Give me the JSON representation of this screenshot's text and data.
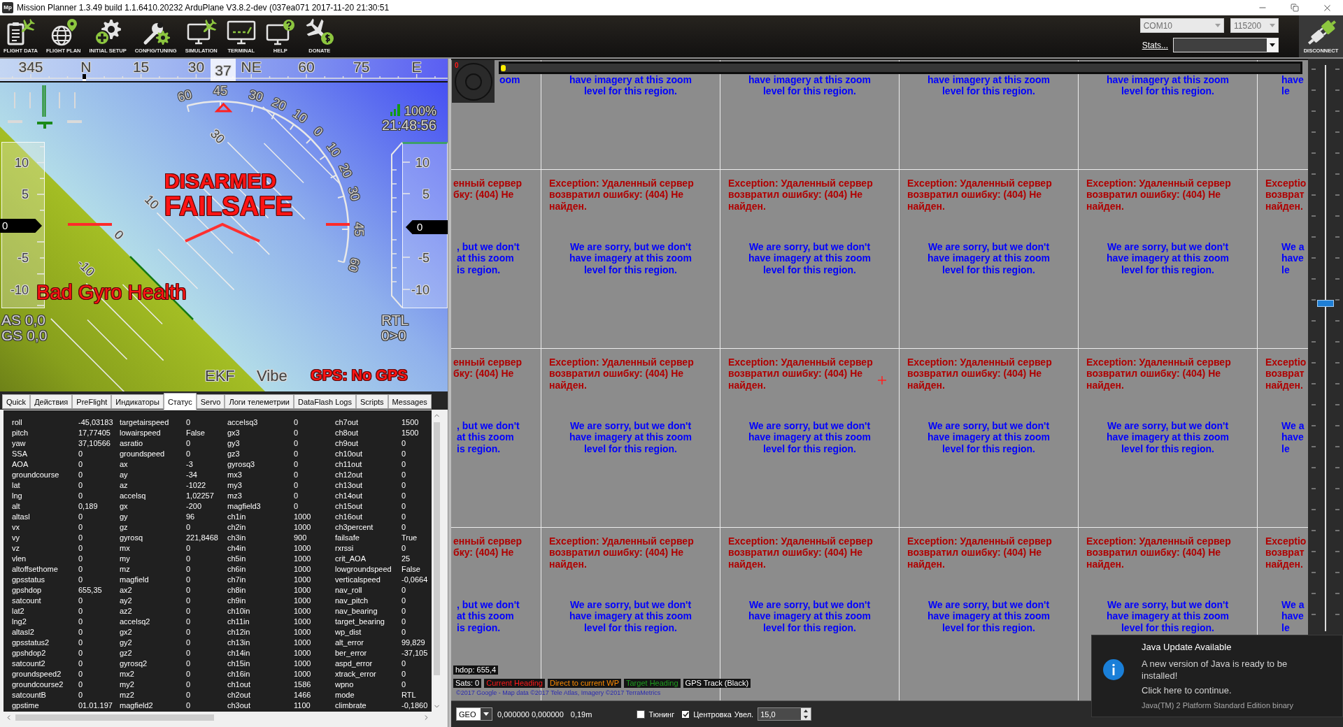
{
  "window": {
    "icon_text": "Mp",
    "title": "Mission Planner 1.3.49 build 1.1.6410.20232 ArduPlane V3.8.2-dev (037ea071 2017-11-20 21:30:51"
  },
  "toolbar": {
    "buttons": [
      {
        "kind": "flight_data",
        "label": "FLIGHT DATA"
      },
      {
        "kind": "flight_plan",
        "label": "FLIGHT PLAN"
      },
      {
        "kind": "initial_setup",
        "label": "INITIAL SETUP"
      },
      {
        "kind": "config",
        "label": "CONFIG/TUNING"
      },
      {
        "kind": "simulation",
        "label": "SIMULATION"
      },
      {
        "kind": "terminal",
        "label": "TERMINAL"
      },
      {
        "kind": "help",
        "label": "HELP"
      },
      {
        "kind": "donate",
        "label": "DONATE"
      }
    ],
    "port": {
      "value": "COM10",
      "disabled": true
    },
    "baud": {
      "value": "115200",
      "disabled": true
    },
    "stats_link": "Stats...",
    "connect_button": "DISCONNECT"
  },
  "hud": {
    "compass": {
      "marks": [
        "345",
        "N",
        "15",
        "30",
        "NE",
        "60",
        "75",
        "E"
      ],
      "heading": "37"
    },
    "roll_scale": [
      "60",
      "45",
      "30",
      "20",
      "10",
      "0",
      "10",
      "20",
      "30",
      "45",
      "60"
    ],
    "pitch_labels": [
      "30",
      "10",
      "0",
      "-10"
    ],
    "battery": "100%",
    "clock": "21:48:56",
    "arm_status": "DISARMED",
    "failsafe": "FAILSAFE",
    "message": "Bad Gyro Health",
    "speed_tape": {
      "labels": [
        "10",
        "5",
        "-5",
        "-10"
      ],
      "value": "0"
    },
    "alt_tape": {
      "labels": [
        "10",
        "5",
        "-5",
        "-10"
      ],
      "value": "0"
    },
    "airspeed": "AS 0,0",
    "groundspeed": "GS 0,0",
    "mode": "RTL",
    "waypoint": "0>0",
    "indicators": [
      {
        "label": "EKF",
        "alert": false
      },
      {
        "label": "Vibe",
        "alert": false
      },
      {
        "label": "GPS: No GPS",
        "alert": true
      }
    ]
  },
  "tabs": [
    {
      "label": "Quick",
      "selected": false
    },
    {
      "label": "Действия",
      "selected": false
    },
    {
      "label": "PreFlight",
      "selected": false
    },
    {
      "label": "Индикаторы",
      "selected": false
    },
    {
      "label": "Статус",
      "selected": true
    },
    {
      "label": "Servo",
      "selected": false
    },
    {
      "label": "Логи телеметрии",
      "selected": false
    },
    {
      "label": "DataFlash Logs",
      "selected": false
    },
    {
      "label": "Scripts",
      "selected": false
    },
    {
      "label": "Messages",
      "selected": false
    }
  ],
  "status_table": {
    "rows": [
      [
        "roll",
        "-45,03183",
        "targetairspeed",
        "0",
        "accelsq3",
        "0",
        "ch7out",
        "1500"
      ],
      [
        "pitch",
        "17,77405",
        "lowairspeed",
        "False",
        "gx3",
        "0",
        "ch8out",
        "1500"
      ],
      [
        "yaw",
        "37,10566",
        "asratio",
        "0",
        "gy3",
        "0",
        "ch9out",
        "0"
      ],
      [
        "SSA",
        "0",
        "groundspeed",
        "0",
        "gz3",
        "0",
        "ch10out",
        "0"
      ],
      [
        "AOA",
        "0",
        "ax",
        "-3",
        "gyrosq3",
        "0",
        "ch11out",
        "0"
      ],
      [
        "groundcourse",
        "0",
        "ay",
        "-34",
        "mx3",
        "0",
        "ch12out",
        "0"
      ],
      [
        "lat",
        "0",
        "az",
        "-1022",
        "my3",
        "0",
        "ch13out",
        "0"
      ],
      [
        "lng",
        "0",
        "accelsq",
        "1,02257",
        "mz3",
        "0",
        "ch14out",
        "0"
      ],
      [
        "alt",
        "0,189",
        "gx",
        "-200",
        "magfield3",
        "0",
        "ch15out",
        "0"
      ],
      [
        "altasl",
        "0",
        "gy",
        "96",
        "ch1in",
        "1000",
        "ch16out",
        "0"
      ],
      [
        "vx",
        "0",
        "gz",
        "0",
        "ch2in",
        "1000",
        "ch3percent",
        "0"
      ],
      [
        "vy",
        "0",
        "gyrosq",
        "221,8468",
        "ch3in",
        "900",
        "failsafe",
        "True"
      ],
      [
        "vz",
        "0",
        "mx",
        "0",
        "ch4in",
        "1000",
        "rxrssi",
        "0"
      ],
      [
        "vlen",
        "0",
        "my",
        "0",
        "ch5in",
        "1000",
        "crit_AOA",
        "25"
      ],
      [
        "altoffsethome",
        "0",
        "mz",
        "0",
        "ch6in",
        "1000",
        "lowgroundspeed",
        "False"
      ],
      [
        "gpsstatus",
        "0",
        "magfield",
        "0",
        "ch7in",
        "1000",
        "verticalspeed",
        "-0,0664"
      ],
      [
        "gpshdop",
        "655,35",
        "ax2",
        "0",
        "ch8in",
        "1000",
        "nav_roll",
        "0"
      ],
      [
        "satcount",
        "0",
        "ay2",
        "0",
        "ch9in",
        "1000",
        "nav_pitch",
        "0"
      ],
      [
        "lat2",
        "0",
        "az2",
        "0",
        "ch10in",
        "1000",
        "nav_bearing",
        "0"
      ],
      [
        "lng2",
        "0",
        "accelsq2",
        "0",
        "ch11in",
        "1000",
        "target_bearing",
        "0"
      ],
      [
        "altasl2",
        "0",
        "gx2",
        "0",
        "ch12in",
        "1000",
        "wp_dist",
        "0"
      ],
      [
        "gpsstatus2",
        "0",
        "gy2",
        "0",
        "ch13in",
        "1000",
        "alt_error",
        "99,829"
      ],
      [
        "gpshdop2",
        "0",
        "gz2",
        "0",
        "ch14in",
        "1000",
        "ber_error",
        "-37,105"
      ],
      [
        "satcount2",
        "0",
        "gyrosq2",
        "0",
        "ch15in",
        "1000",
        "aspd_error",
        "0"
      ],
      [
        "groundspeed2",
        "0",
        "mx2",
        "0",
        "ch16in",
        "1000",
        "xtrack_error",
        "0"
      ],
      [
        "groundcourse2",
        "0",
        "my2",
        "0",
        "ch1out",
        "1586",
        "wpno",
        "0"
      ],
      [
        "satcountB",
        "0",
        "mz2",
        "0",
        "ch2out",
        "1466",
        "mode",
        "RTL"
      ],
      [
        "gpstime",
        "01.01.197",
        "magfield2",
        "0",
        "ch3out",
        "1100",
        "climbrate",
        "-0,1860"
      ]
    ]
  },
  "map": {
    "tiles": [
      [
        {
          "message": [
            "oom"
          ]
        },
        {
          "message": [
            "have imagery at this zoom",
            "level for this region."
          ]
        },
        {
          "message": [
            "have imagery at this zoom",
            "level for this region."
          ]
        },
        {
          "message": [
            "have imagery at this zoom",
            "level for this region."
          ]
        },
        {
          "message": [
            "have imagery at this zoom",
            "level for this region."
          ]
        },
        {
          "message": [
            "have",
            "le"
          ]
        }
      ],
      [
        {
          "error": [
            "енный сервер",
            "бку: (404) Не"
          ],
          "message": [
            ", but we don't",
            "at this zoom",
            "is region."
          ]
        },
        {
          "error": [
            "Exception: Удаленный сервер",
            "возвратил ошибку: (404) Не",
            "найден."
          ],
          "message": [
            "We are sorry, but we don't",
            "have imagery at this zoom",
            "level for this region."
          ]
        },
        {
          "error": [
            "Exception: Удаленный сервер",
            "возвратил ошибку: (404) Не",
            "найден."
          ],
          "message": [
            "We are sorry, but we don't",
            "have imagery at this zoom",
            "level for this region."
          ]
        },
        {
          "error": [
            "Exception: Удаленный сервер",
            "возвратил ошибку: (404) Не",
            "найден."
          ],
          "message": [
            "We are sorry, but we don't",
            "have imagery at this zoom",
            "level for this region."
          ]
        },
        {
          "error": [
            "Exception: Удаленный сервер",
            "возвратил ошибку: (404) Не",
            "найден."
          ],
          "message": [
            "We are sorry, but we don't",
            "have imagery at this zoom",
            "level for this region."
          ]
        },
        {
          "error": [
            "Exceptio",
            "возврат",
            "найден."
          ],
          "message": [
            "We a",
            "have",
            "le"
          ]
        }
      ],
      [
        {
          "error": [
            "енный сервер",
            "бку: (404) Не"
          ],
          "message": [
            ", but we don't",
            "at this zoom",
            "is region."
          ]
        },
        {
          "error": [
            "Exception: Удаленный сервер",
            "возвратил ошибку: (404) Не",
            "найден."
          ],
          "message": [
            "We are sorry, but we don't",
            "have imagery at this zoom",
            "level for this region."
          ]
        },
        {
          "error": [
            "Exception: Удаленный сервер",
            "возвратил ошибку: (404) Не",
            "найден."
          ],
          "message": [
            "We are sorry, but we don't",
            "have imagery at this zoom",
            "level for this region."
          ]
        },
        {
          "error": [
            "Exception: Удаленный сервер",
            "возвратил ошибку: (404) Не",
            "найден."
          ],
          "message": [
            "We are sorry, but we don't",
            "have imagery at this zoom",
            "level for this region."
          ]
        },
        {
          "error": [
            "Exception: Удаленный сервер",
            "возвратил ошибку: (404) Не",
            "найден."
          ],
          "message": [
            "We are sorry, but we don't",
            "have imagery at this zoom",
            "level for this region."
          ]
        },
        {
          "error": [
            "Exceptio",
            "возврат",
            "найден."
          ],
          "message": [
            "We a",
            "have",
            "le"
          ]
        }
      ],
      [
        {
          "error": [
            "енный сервер",
            "бку: (404) Не"
          ],
          "message": [
            ", but we don't",
            "at this zoom",
            "is region."
          ]
        },
        {
          "error": [
            "Exception: Удаленный сервер",
            "возвратил ошибку: (404) Не",
            "найден."
          ],
          "message": [
            "We are sorry, but we don't",
            "have imagery at this zoom",
            "level for this region."
          ]
        },
        {
          "error": [
            "Exception: Удаленный сервер",
            "возвратил ошибку: (404) Не",
            "найден."
          ],
          "message": [
            "We are sorry, but we don't",
            "have imagery at this zoom",
            "level for this region."
          ]
        },
        {
          "error": [
            "Exception: Удаленный сервер",
            "возвратил ошибку: (404) Не",
            "найден."
          ],
          "message": [
            "We are sorry, but we don't",
            "have imagery at this zoom",
            "level for this region."
          ]
        },
        {
          "error": [
            "Exception: Удаленный сервер",
            "возвратил ошибку: (404) Не",
            "найден."
          ],
          "message": [
            "We are sorry, but we don't",
            "have imagery at this zoom",
            "level for this region."
          ]
        },
        {
          "error": [
            "Exceptio",
            "возврат",
            "найден."
          ],
          "message": [
            "We a",
            "have",
            "le"
          ]
        }
      ]
    ],
    "gauge_value": "0",
    "progress": {
      "level": 0
    },
    "hdop": "hdop: 655,4",
    "legend": [
      {
        "label": "Sats: 0",
        "kind": "sats"
      },
      {
        "label": "Current Heading",
        "kind": "current_heading"
      },
      {
        "label": "Direct to current WP",
        "kind": "direct_wp"
      },
      {
        "label": "Target Heading",
        "kind": "target_heading"
      },
      {
        "label": "GPS Track (Black)",
        "kind": "gps_track"
      }
    ],
    "copyright": "©2017 Google - Map data ©2017 Tele Atlas, Imagery ©2017 TerraMetrics",
    "zoom_slider": {
      "level": 0.58
    }
  },
  "map_bar": {
    "coord_system": "GEO",
    "coordinates": "0,000000 0,000000",
    "distance": "0,19m",
    "checkboxes": [
      {
        "label": "Тюнинг",
        "checked": false
      },
      {
        "label": "Центровка",
        "checked": true
      }
    ],
    "zoom_label": "Увел.",
    "zoom_value": "15,0"
  },
  "notification": {
    "title": "Java Update Available",
    "body": "A new version of Java is ready to be installed!",
    "action": "Click here to continue.",
    "footer": "Java(TM) 2 Platform Standard Edition binary"
  }
}
